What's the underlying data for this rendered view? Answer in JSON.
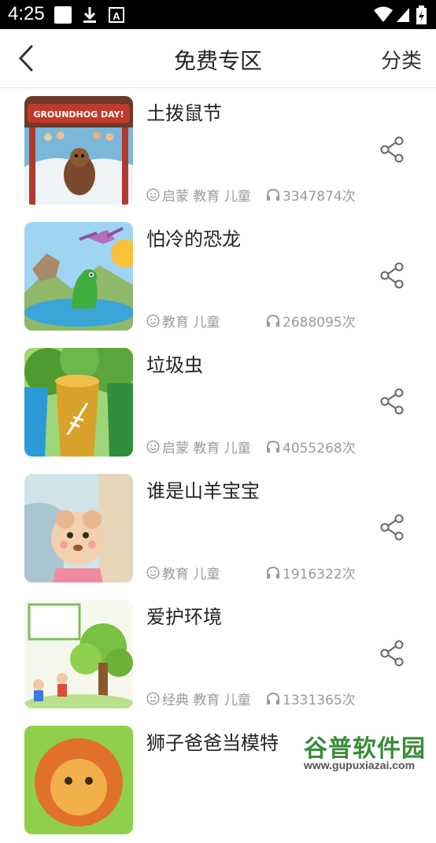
{
  "status_bar": {
    "time": "4:25"
  },
  "header": {
    "title": "免费专区",
    "category_label": "分类"
  },
  "items": [
    {
      "title": "土拨鼠节",
      "tags": "启蒙 教育 儿童",
      "plays": "3347874次",
      "thumb_text": "GROUNDHOG DAY!"
    },
    {
      "title": "怕冷的恐龙",
      "tags": "教育 儿童",
      "plays": "2688095次"
    },
    {
      "title": "垃圾虫",
      "tags": "启蒙 教育 儿童",
      "plays": "4055268次"
    },
    {
      "title": "谁是山羊宝宝",
      "tags": "教育 儿童",
      "plays": "1916322次"
    },
    {
      "title": "爱护环境",
      "tags": "经典 教育 儿童",
      "plays": "1331365次"
    },
    {
      "title": "狮子爸爸当模特",
      "tags": "",
      "plays": ""
    }
  ],
  "watermark": {
    "text": "谷普软件园",
    "url": "www.gupuxiazai.com"
  },
  "colors": {
    "meta_gray": "#9a9a9a",
    "title": "#222222",
    "watermark_green": "#3a8b3a"
  }
}
